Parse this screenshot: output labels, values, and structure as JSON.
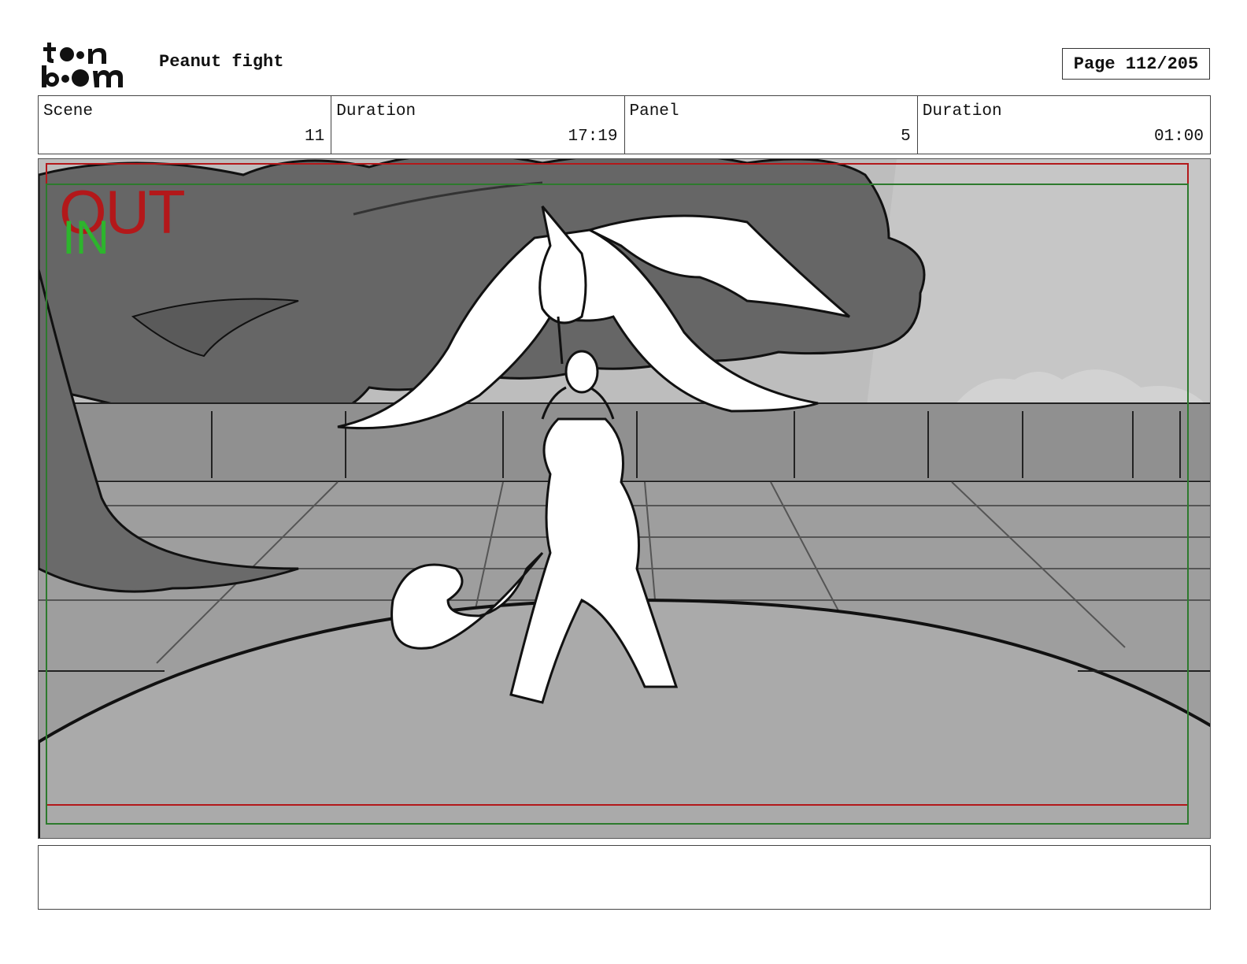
{
  "header": {
    "logo_line1": "toon",
    "logo_line2": "boom",
    "project_title": "Peanut fight",
    "page_label": "Page 112/205"
  },
  "info": {
    "scene_label": "Scene",
    "scene_value": "11",
    "scene_duration_label": "Duration",
    "scene_duration_value": "17:19",
    "panel_label": "Panel",
    "panel_value": "5",
    "panel_duration_label": "Duration",
    "panel_duration_value": "01:00"
  },
  "frame_tags": {
    "out": "OUT",
    "in": "IN"
  },
  "colors": {
    "out_frame": "#b3181a",
    "in_frame": "#2d7a2d"
  },
  "notes": {
    "text": ""
  }
}
